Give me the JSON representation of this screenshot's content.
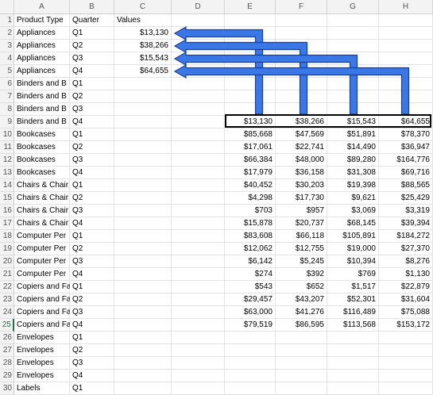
{
  "columns": [
    "A",
    "B",
    "C",
    "D",
    "E",
    "F",
    "G",
    "H"
  ],
  "row_numbers": [
    1,
    2,
    3,
    4,
    5,
    6,
    7,
    8,
    9,
    10,
    11,
    12,
    13,
    14,
    15,
    16,
    17,
    18,
    19,
    20,
    21,
    22,
    23,
    24,
    25,
    26,
    27,
    28,
    29,
    30
  ],
  "active_row": 25,
  "col_a_b": [
    [
      "Product Type",
      "Quarter"
    ],
    [
      "Appliances",
      "Q1"
    ],
    [
      "Appliances",
      "Q2"
    ],
    [
      "Appliances",
      "Q3"
    ],
    [
      "Appliances",
      "Q4"
    ],
    [
      "Binders and B",
      "Q1"
    ],
    [
      "Binders and B",
      "Q2"
    ],
    [
      "Binders and B",
      "Q3"
    ],
    [
      "Binders and B",
      "Q4"
    ],
    [
      "Bookcases",
      "Q1"
    ],
    [
      "Bookcases",
      "Q2"
    ],
    [
      "Bookcases",
      "Q3"
    ],
    [
      "Bookcases",
      "Q4"
    ],
    [
      "Chairs & Chair",
      "Q1"
    ],
    [
      "Chairs & Chair",
      "Q2"
    ],
    [
      "Chairs & Chair",
      "Q3"
    ],
    [
      "Chairs & Chair",
      "Q4"
    ],
    [
      "Computer Per",
      "Q1"
    ],
    [
      "Computer Per",
      "Q2"
    ],
    [
      "Computer Per",
      "Q3"
    ],
    [
      "Computer Per",
      "Q4"
    ],
    [
      "Copiers and Fa",
      "Q1"
    ],
    [
      "Copiers and Fa",
      "Q2"
    ],
    [
      "Copiers and Fa",
      "Q3"
    ],
    [
      "Copiers and Fa",
      "Q4"
    ],
    [
      "Envelopes",
      "Q1"
    ],
    [
      "Envelopes",
      "Q2"
    ],
    [
      "Envelopes",
      "Q3"
    ],
    [
      "Envelopes",
      "Q4"
    ],
    [
      "Labels",
      "Q1"
    ]
  ],
  "col_c_header": "Values",
  "col_c_values": [
    "$13,130",
    "$38,266",
    "$15,543",
    "$64,655"
  ],
  "grid_rows": [
    [
      "$13,130",
      "$38,266",
      "$15,543",
      "$64,655"
    ],
    [
      "$85,668",
      "$47,569",
      "$51,891",
      "$78,370"
    ],
    [
      "$17,061",
      "$22,741",
      "$14,490",
      "$36,947"
    ],
    [
      "$66,384",
      "$48,000",
      "$89,280",
      "$164,776"
    ],
    [
      "$17,979",
      "$36,158",
      "$31,308",
      "$69,716"
    ],
    [
      "$40,452",
      "$30,203",
      "$19,398",
      "$88,565"
    ],
    [
      "$4,298",
      "$17,730",
      "$9,621",
      "$25,429"
    ],
    [
      "$703",
      "$957",
      "$3,069",
      "$3,319"
    ],
    [
      "$15,878",
      "$20,737",
      "$68,145",
      "$39,394"
    ],
    [
      "$83,608",
      "$66,118",
      "$105,891",
      "$184,272"
    ],
    [
      "$12,062",
      "$12,755",
      "$19,000",
      "$27,370"
    ],
    [
      "$6,142",
      "$5,245",
      "$10,394",
      "$8,276"
    ],
    [
      "$274",
      "$392",
      "$769",
      "$1,130"
    ],
    [
      "$543",
      "$652",
      "$1,517",
      "$22,879"
    ],
    [
      "$29,457",
      "$43,207",
      "$52,301",
      "$31,604"
    ],
    [
      "$63,000",
      "$41,276",
      "$116,489",
      "$75,088"
    ],
    [
      "$79,519",
      "$86,595",
      "$113,568",
      "$153,172"
    ]
  ],
  "colors": {
    "arrow_fill": "#3b78e7",
    "arrow_stroke": "#1a3f9a",
    "outline": "#000000",
    "active_row": "#1e7145"
  }
}
